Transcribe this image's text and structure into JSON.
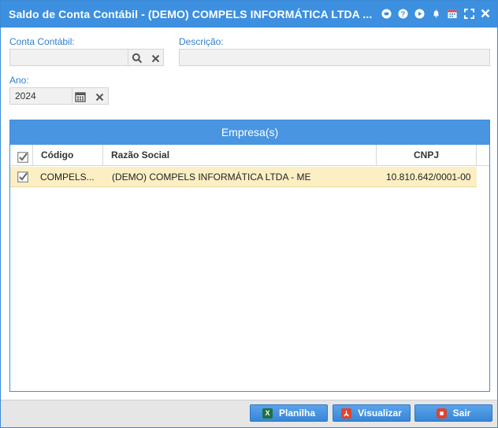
{
  "window": {
    "title": "Saldo de Conta Contábil - (DEMO) COMPELS INFORMÁTICA LTDA ...",
    "accent": "#3d8fe0",
    "title_icons": [
      "chat-icon",
      "help-icon",
      "play-icon",
      "bell-icon",
      "calendar-icon",
      "fullscreen-icon",
      "close-icon"
    ]
  },
  "form": {
    "conta_label": "Conta Contábil:",
    "conta_value": "",
    "descricao_label": "Descrição:",
    "descricao_value": "",
    "ano_label": "Ano:",
    "ano_value": "2024"
  },
  "grid": {
    "title": "Empresa(s)",
    "columns": {
      "codigo": "Código",
      "razao": "Razão Social",
      "cnpj": "CNPJ"
    },
    "rows": [
      {
        "checked": true,
        "codigo": "COMPELS...",
        "razao": "(DEMO) COMPELS INFORMÁTICA LTDA - ME",
        "cnpj": "10.810.642/0001-00"
      }
    ],
    "selected_row_color": "#fcefc4"
  },
  "footer": {
    "planilha_label": "Planilha",
    "visualizar_label": "Visualizar",
    "sair_label": "Sair"
  }
}
